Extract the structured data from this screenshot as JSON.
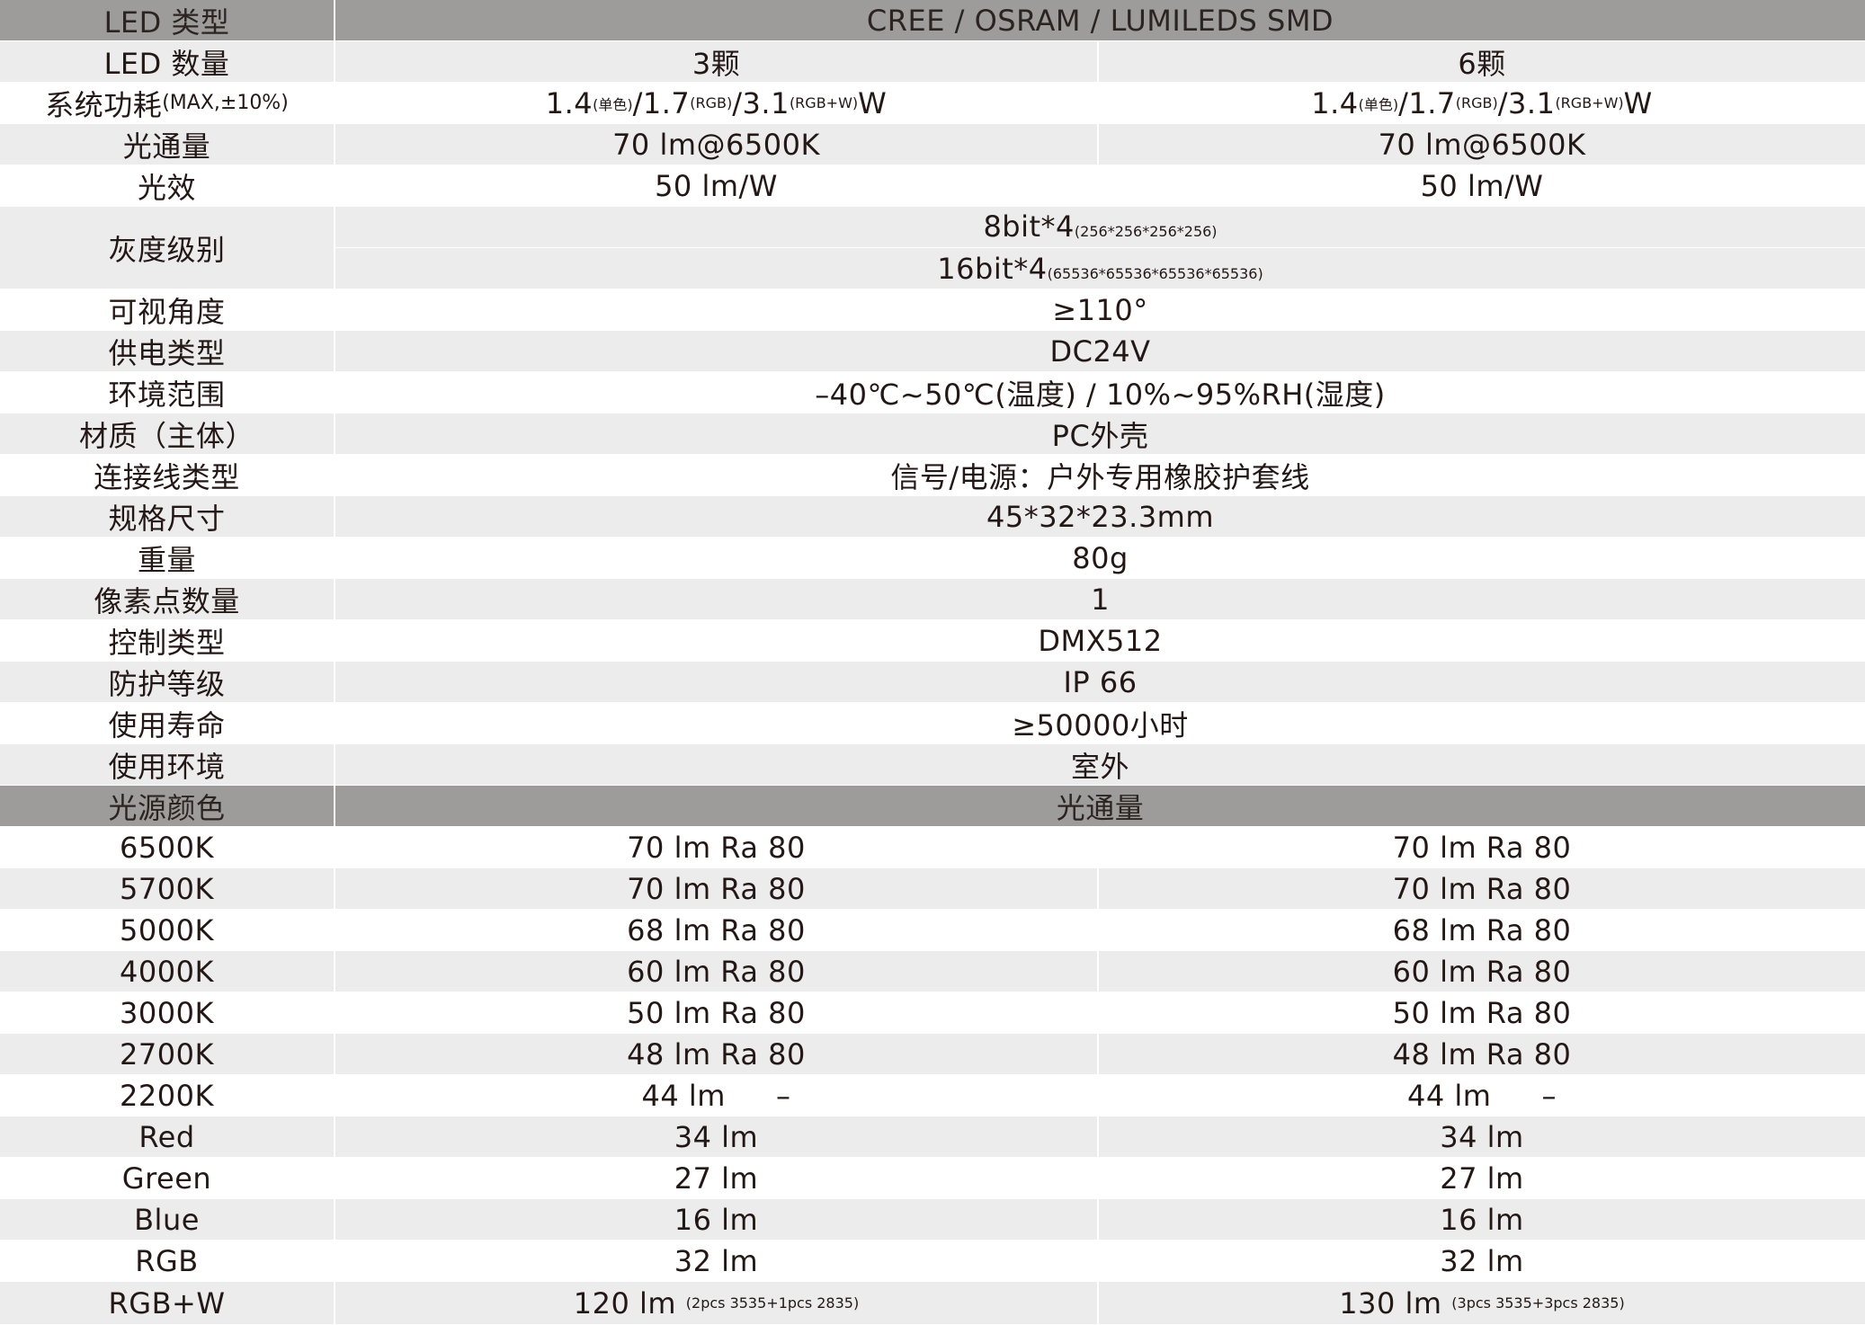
{
  "header": {
    "label": "LED 类型",
    "value": "CREE / OSRAM / LUMILEDS SMD"
  },
  "led_count": {
    "label": "LED 数量",
    "a": "3颗",
    "b": "6颗"
  },
  "power": {
    "label": "系统功耗",
    "label_small": "(MAX,±10%)",
    "a": {
      "v1": "1.4",
      "s1": "(单色)",
      "v2": "/1.7",
      "s2": "(RGB)",
      "v3": "/3.1",
      "s3": "(RGB+W)",
      "unit": "W"
    },
    "b": {
      "v1": "1.4",
      "s1": "(单色)",
      "v2": "/1.7",
      "s2": "(RGB)",
      "v3": "/3.1",
      "s3": "(RGB+W)",
      "unit": "W"
    }
  },
  "flux": {
    "label": "光通量",
    "a": "70 lm@6500K",
    "b": "70 lm@6500K"
  },
  "efficacy": {
    "label": "光效",
    "a": "50 lm/W",
    "b": "50 lm/W"
  },
  "grayscale": {
    "label": "灰度级别",
    "line1": "8bit*4",
    "line1_small": "(256*256*256*256)",
    "line2": "16bit*4",
    "line2_small": "(65536*65536*65536*65536)"
  },
  "spec_rows": [
    {
      "label": "可视角度",
      "value": "≥110°"
    },
    {
      "label": "供电类型",
      "value": "DC24V"
    },
    {
      "label": "环境范围",
      "value": "–40℃~50℃(温度) / 10%~95%RH(湿度)"
    },
    {
      "label": "材质（主体）",
      "value": "PC外壳"
    },
    {
      "label": "连接线类型",
      "value": "信号/电源：户外专用橡胶护套线"
    },
    {
      "label": "规格尺寸",
      "value": "45*32*23.3mm"
    },
    {
      "label": "重量",
      "value": "80g"
    },
    {
      "label": "像素点数量",
      "value": "1"
    },
    {
      "label": "控制类型",
      "value": "DMX512"
    },
    {
      "label": "防护等级",
      "value": "IP 66"
    },
    {
      "label": "使用寿命",
      "value": "≥50000小时"
    },
    {
      "label": "使用环境",
      "value": "室外"
    }
  ],
  "flux_header": {
    "label": "光源颜色",
    "value": "光通量"
  },
  "flux_rows": [
    {
      "color": "6500K",
      "a": "70 lm Ra 80",
      "b": "70 lm Ra 80"
    },
    {
      "color": "5700K",
      "a": "70 lm Ra 80",
      "b": "70 lm Ra 80"
    },
    {
      "color": "5000K",
      "a": "68 lm Ra 80",
      "b": "68 lm Ra 80"
    },
    {
      "color": "4000K",
      "a": "60 lm Ra 80",
      "b": "60 lm Ra 80"
    },
    {
      "color": "3000K",
      "a": "50 lm Ra 80",
      "b": "50 lm Ra 80"
    },
    {
      "color": "2700K",
      "a": "48 lm Ra 80",
      "b": "48 lm Ra 80"
    },
    {
      "color": "2200K",
      "a": "44 lm",
      "a_ra": "–",
      "b": "44 lm",
      "b_ra": "–"
    },
    {
      "color": "Red",
      "a": "34 lm",
      "b": "34 lm"
    },
    {
      "color": "Green",
      "a": "27 lm",
      "b": "27 lm"
    },
    {
      "color": "Blue",
      "a": "16 lm",
      "b": "16 lm"
    },
    {
      "color": "RGB",
      "a": "32 lm",
      "b": "32 lm"
    },
    {
      "color": "RGB+W",
      "a": "120 lm",
      "a_note": "(2pcs 3535+1pcs 2835)",
      "b": "130 lm",
      "b_note": "(3pcs 3535+3pcs 2835)"
    }
  ],
  "colors": {
    "header_bg": "#9e9c9b",
    "stripe_bg": "#ececec",
    "text": "#231815"
  }
}
